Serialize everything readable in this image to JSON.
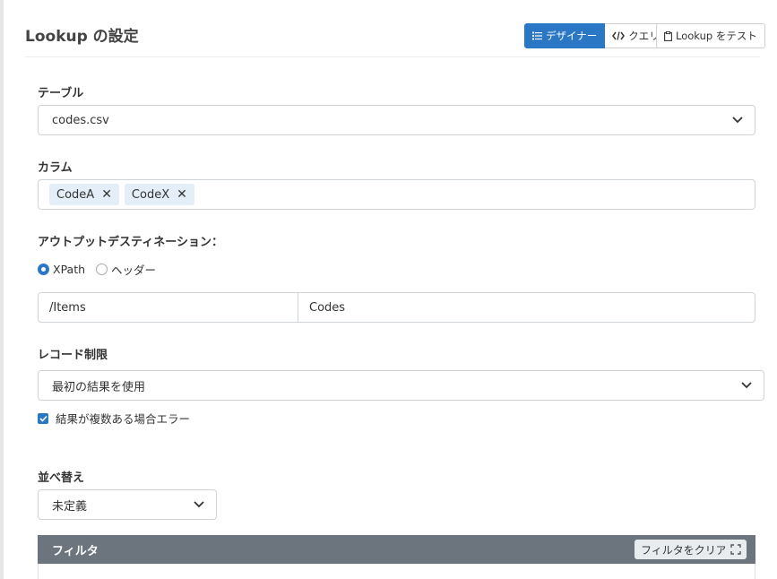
{
  "header": {
    "title": "Lookup の設定",
    "designer_label": "デザイナー",
    "query_label": "クエリ",
    "test_label": "Lookup をテスト"
  },
  "table": {
    "label": "テーブル",
    "value": "codes.csv"
  },
  "columns": {
    "label": "カラム",
    "tags": [
      "CodeA",
      "CodeX"
    ]
  },
  "output": {
    "label": "アウトプットデスティネーション：",
    "options": [
      "XPath",
      "ヘッダー"
    ],
    "selected": "XPath",
    "path": "/Items",
    "name": "Codes"
  },
  "record_limit": {
    "label": "レコード制限",
    "value": "最初の結果を使用",
    "error_check_label": "結果が複数ある場合エラー",
    "error_check_checked": true
  },
  "sort": {
    "label": "並べ替え",
    "value": "未定義"
  },
  "filter": {
    "title": "フィルタ",
    "clear_label": "フィルタをクリア"
  },
  "colors": {
    "accent": "#2a78c5",
    "filter_bar": "#6c757d"
  }
}
